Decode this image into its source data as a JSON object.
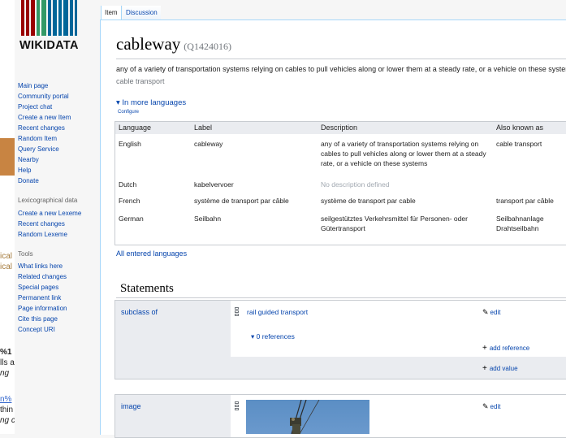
{
  "left_fragments": [
    {
      "text": "ical",
      "style": "gold"
    },
    {
      "text": "ical",
      "style": "gold"
    },
    {
      "text": "%1",
      "style": "b"
    },
    {
      "text": "lls a",
      "style": ""
    },
    {
      "text": "ng",
      "style": "i"
    },
    {
      "text": "n%",
      "style": "link"
    },
    {
      "text": "thin",
      "style": ""
    },
    {
      "text": "ng c",
      "style": "i"
    }
  ],
  "sidebar": {
    "logo_text": "WIKIDATA",
    "logo_colors": [
      "#990000",
      "#339966",
      "#006699"
    ],
    "navigation": [
      "Main page",
      "Community portal",
      "Project chat",
      "Create a new Item",
      "Recent changes",
      "Random Item",
      "Query Service",
      "Nearby",
      "Help",
      "Donate"
    ],
    "lexicographical_heading": "Lexicographical data",
    "lexicographical": [
      "Create a new Lexeme",
      "Recent changes",
      "Random Lexeme"
    ],
    "tools_heading": "Tools",
    "tools": [
      "What links here",
      "Related changes",
      "Special pages",
      "Permanent link",
      "Page information",
      "Cite this page",
      "Concept URI"
    ]
  },
  "tabs": {
    "item": "Item",
    "discussion": "Discussion"
  },
  "item": {
    "label": "cableway",
    "id": "(Q1424016)",
    "description": "any of a variety of transportation systems relying on cables to pull vehicles along or lower them at a steady rate, or a vehicle on these systems",
    "alias": "cable transport"
  },
  "languages": {
    "toggle": "▾ In more languages",
    "configure": "Configure",
    "headers": {
      "language": "Language",
      "label": "Label",
      "description": "Description",
      "also_known_as": "Also known as"
    },
    "rows": [
      {
        "language": "English",
        "label": "cableway",
        "description": "any of a variety of transportation systems relying on cables to pull vehicles along or lower them at a steady rate, or a vehicle on these systems",
        "aliases": "cable transport"
      },
      {
        "language": "Dutch",
        "label": "kabelvervoer",
        "description": "No description defined",
        "aliases": ""
      },
      {
        "language": "French",
        "label": "système de transport par câble",
        "description": "système de transport par cable",
        "aliases": "transport par câble"
      },
      {
        "language": "German",
        "label": "Seilbahn",
        "description": "seilgestütztes Verkehrsmittel für Personen- oder Gütertransport",
        "aliases": "Seilbahnanlage Drahtseilbahn"
      }
    ],
    "all_entered": "All entered languages"
  },
  "statements": {
    "heading": "Statements",
    "items": [
      {
        "property": "subclass of",
        "value": "rail guided transport",
        "edit": "edit",
        "references": "▾ 0 references",
        "add_reference": "add reference",
        "add_value": "add value"
      },
      {
        "property": "image",
        "edit": "edit"
      }
    ]
  },
  "icons": {
    "edit": "pencil-icon",
    "add": "plus-icon",
    "rank": "normal-rank-icon"
  }
}
